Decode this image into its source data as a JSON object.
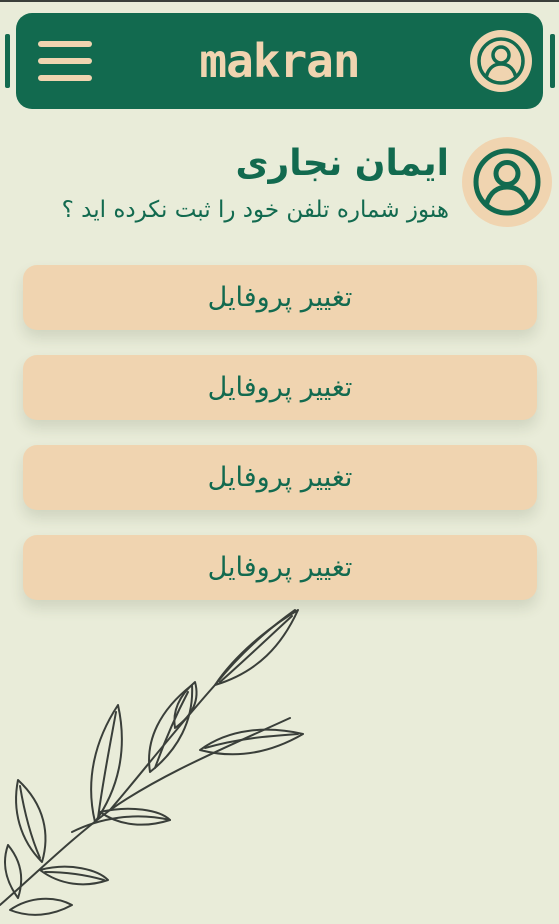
{
  "header": {
    "brand": "makran",
    "menu_icon": "hamburger-menu-icon",
    "account_icon": "user-circle-icon"
  },
  "profile": {
    "name": "ایمان نجاری",
    "subtitle": "هنوز شماره تلفن خود را ثبت نکرده اید ؟",
    "avatar_icon": "user-circle-icon"
  },
  "menu": {
    "items": [
      {
        "label": "تغییر پروفایل"
      },
      {
        "label": "تغییر پروفایل"
      },
      {
        "label": "تغییر پروفایل"
      },
      {
        "label": "تغییر پروفایل"
      }
    ]
  },
  "colors": {
    "background": "#e9ecd9",
    "primary": "#126a4f",
    "accent": "#f0d4b0",
    "decoration": "#3a3f3a"
  }
}
